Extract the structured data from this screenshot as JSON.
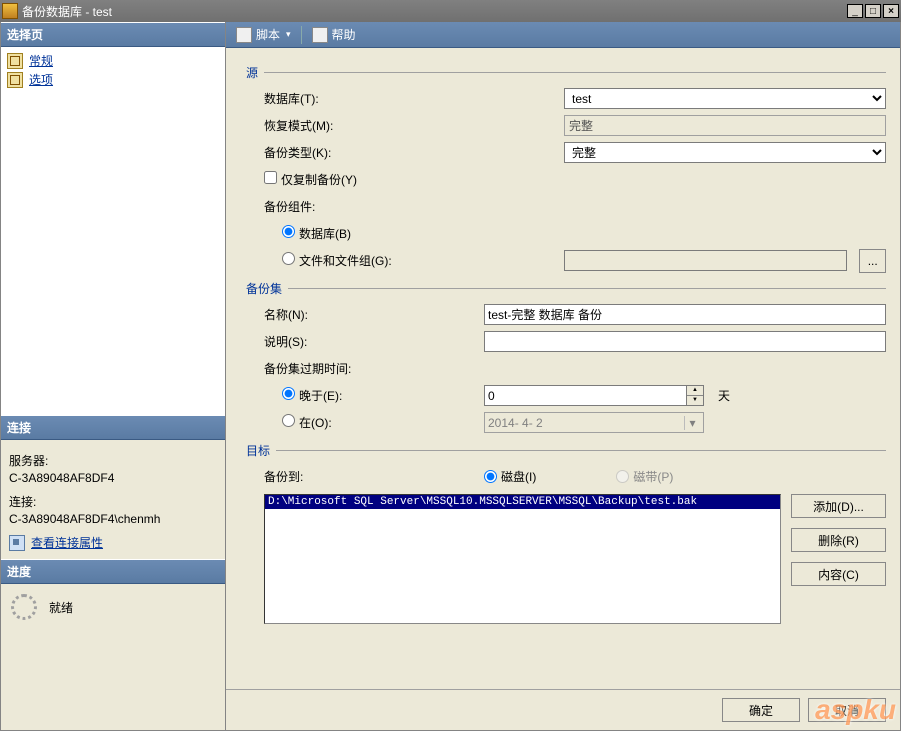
{
  "window": {
    "title": "备份数据库 - test"
  },
  "left": {
    "select_header": "选择页",
    "pages": [
      "常规",
      "选项"
    ],
    "conn_header": "连接",
    "server_label": "服务器:",
    "server_value": "C-3A89048AF8DF4",
    "connection_label": "连接:",
    "connection_value": "C-3A89048AF8DF4\\chenmh",
    "view_link": "查看连接属性",
    "progress_header": "进度",
    "progress_status": "就绪"
  },
  "toolbar": {
    "script": "脚本",
    "help": "帮助"
  },
  "form": {
    "source_legend": "源",
    "database_label": "数据库(T):",
    "database_value": "test",
    "recovery_label": "恢复模式(M):",
    "recovery_value": "完整",
    "backup_type_label": "备份类型(K):",
    "backup_type_value": "完整",
    "copy_only_label": "仅复制备份(Y)",
    "component_label": "备份组件:",
    "component_db": "数据库(B)",
    "component_fg": "文件和文件组(G):",
    "set_legend": "备份集",
    "name_label": "名称(N):",
    "name_value": "test-完整 数据库 备份",
    "desc_label": "说明(S):",
    "desc_value": "",
    "expire_label": "备份集过期时间:",
    "after_label": "晚于(E):",
    "after_value": "0",
    "after_unit": "天",
    "on_label": "在(O):",
    "on_value": "2014- 4- 2",
    "target_legend": "目标",
    "backup_to_label": "备份到:",
    "disk_label": "磁盘(I)",
    "tape_label": "磁带(P)",
    "dest_path": "D:\\Microsoft SQL Server\\MSSQL10.MSSQLSERVER\\MSSQL\\Backup\\test.bak",
    "add_btn": "添加(D)...",
    "remove_btn": "删除(R)",
    "contents_btn": "内容(C)"
  },
  "footer": {
    "ok": "确定",
    "cancel": "取消"
  },
  "watermark": "aspku"
}
